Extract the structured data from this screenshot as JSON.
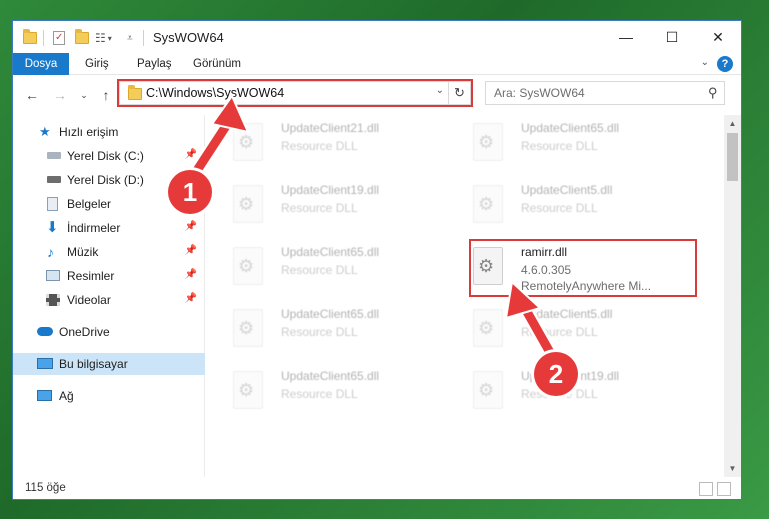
{
  "window": {
    "title": "SysWOW64",
    "controls": {
      "minimize": "—",
      "maximize": "☐",
      "close": "✕"
    }
  },
  "ribbon": {
    "tabs": [
      "Dosya",
      "Giriş",
      "Paylaş",
      "Görünüm"
    ],
    "help": "?"
  },
  "navbar": {
    "address": "C:\\Windows\\SysWOW64",
    "search_placeholder": "Ara: SysWOW64"
  },
  "sidebar": {
    "items": [
      {
        "label": "Hızlı erişim",
        "icon": "star-icon",
        "pinned": false
      },
      {
        "label": "Yerel Disk (C:)",
        "icon": "drive-icon",
        "pinned": true
      },
      {
        "label": "Yerel Disk (D:)",
        "icon": "drive-icon",
        "pinned": true
      },
      {
        "label": "Belgeler",
        "icon": "documents-icon",
        "pinned": true
      },
      {
        "label": "İndirmeler",
        "icon": "download-icon",
        "pinned": true
      },
      {
        "label": "Müzik",
        "icon": "music-icon",
        "pinned": true
      },
      {
        "label": "Resimler",
        "icon": "pictures-icon",
        "pinned": true
      },
      {
        "label": "Videolar",
        "icon": "videos-icon",
        "pinned": true
      },
      {
        "label": "OneDrive",
        "icon": "onedrive-icon",
        "pinned": false
      },
      {
        "label": "Bu bilgisayar",
        "icon": "computer-icon",
        "pinned": false,
        "selected": true
      },
      {
        "label": "Ağ",
        "icon": "network-icon",
        "pinned": false
      }
    ]
  },
  "files": {
    "left_column": [
      {
        "name": "UpdateClient21.dll",
        "type": "Resource DLL"
      },
      {
        "name": "UpdateClient19.dll",
        "type": "Resource DLL"
      },
      {
        "name": "UpdateClient65.dll",
        "type": "Resource DLL"
      },
      {
        "name": "UpdateClient65.dll",
        "type": "Resource DLL"
      },
      {
        "name": "UpdateClient65.dll",
        "type": "Resource DLL"
      }
    ],
    "right_column": [
      {
        "name": "UpdateClient65.dll",
        "type": "Resource DLL"
      },
      {
        "name": "UpdateClient5.dll",
        "type": "Resource DLL"
      },
      {
        "name": "ramirr.dll",
        "version": "4.6.0.305",
        "company": "RemotelyAnywhere Mi..."
      },
      {
        "name": "UpdateClient5.dll",
        "type": "Resource DLL"
      },
      {
        "name": "UpdateClient19.dll",
        "type": "Resource DLL"
      }
    ]
  },
  "status": {
    "item_count": "115 öğe"
  },
  "callouts": [
    "1",
    "2"
  ],
  "colors": {
    "accent": "#1979ca",
    "highlight": "#d93a3a",
    "selected": "#cce4f7"
  }
}
